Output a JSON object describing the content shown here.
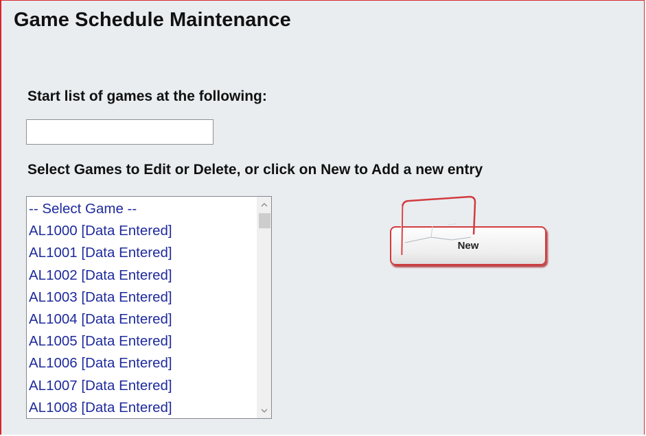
{
  "page": {
    "title": "Game Schedule Maintenance",
    "start_label": "Start list of games at the following:",
    "start_input": {
      "value": "",
      "placeholder": ""
    },
    "select_label": "Select Games to Edit or Delete, or click on New to Add a new entry"
  },
  "games_list": {
    "items": [
      "-- Select Game --",
      "AL1000 [Data Entered]",
      "AL1001 [Data Entered]",
      "AL1002 [Data Entered]",
      "AL1003 [Data Entered]",
      "AL1004 [Data Entered]",
      "AL1005 [Data Entered]",
      "AL1006 [Data Entered]",
      "AL1007 [Data Entered]",
      "AL1008 [Data Entered]"
    ]
  },
  "new_button": {
    "label": "New"
  },
  "colors": {
    "panel_bg": "#e9edf0",
    "border_red": "#d9262b",
    "list_text": "#1e2a9c"
  }
}
